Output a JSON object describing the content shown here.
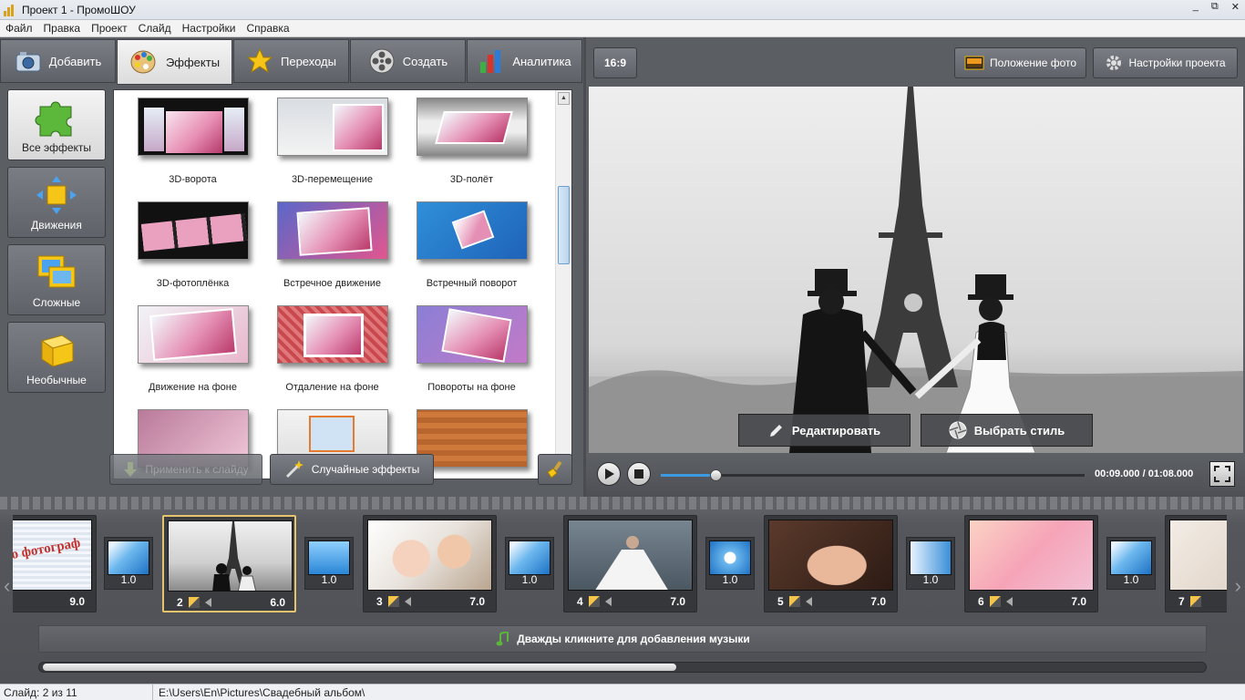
{
  "window": {
    "title": "Проект 1 - ПромоШОУ",
    "controls": [
      "_",
      "⧉",
      "✕"
    ]
  },
  "menu": [
    "Файл",
    "Правка",
    "Проект",
    "Слайд",
    "Настройки",
    "Справка"
  ],
  "tabs": [
    {
      "label": "Добавить",
      "icon": "camera-icon"
    },
    {
      "label": "Эффекты",
      "icon": "palette-icon",
      "active": true
    },
    {
      "label": "Переходы",
      "icon": "star-icon"
    },
    {
      "label": "Создать",
      "icon": "film-reel-icon"
    },
    {
      "label": "Аналитика",
      "icon": "bar-chart-icon"
    }
  ],
  "categories": [
    {
      "label": "Все эффекты",
      "icon": "puzzle-icon",
      "active": true
    },
    {
      "label": "Движения",
      "icon": "move-arrows-icon"
    },
    {
      "label": "Сложные",
      "icon": "layers-icon"
    },
    {
      "label": "Необычные",
      "icon": "cube-icon"
    }
  ],
  "effects": [
    "3D-ворота",
    "3D-перемещение",
    "3D-полёт",
    "3D-фотоплёнка",
    "Встречное движение",
    "Встречный поворот",
    "Движение на фоне",
    "Отдаление на фоне",
    "Повороты на фоне"
  ],
  "effect_buttons": {
    "apply": "Применить к слайду",
    "random": "Случайные эффекты"
  },
  "preview": {
    "aspect": "16:9",
    "photo_position": "Положение фото",
    "project_settings": "Настройки проекта",
    "edit": "Редактировать",
    "choose_style": "Выбрать стиль",
    "timecode": "00:09.000 / 01:08.000",
    "progress": 0.13
  },
  "slides": [
    {
      "num": "",
      "duration": "9.0",
      "label": "то фотограф"
    },
    {
      "num": "2",
      "duration": "6.0",
      "selected": true
    },
    {
      "num": "3",
      "duration": "7.0"
    },
    {
      "num": "4",
      "duration": "7.0"
    },
    {
      "num": "5",
      "duration": "7.0"
    },
    {
      "num": "6",
      "duration": "7.0"
    },
    {
      "num": "7",
      "duration": ""
    }
  ],
  "transitions": [
    "1.0",
    "1.0",
    "1.0",
    "1.0",
    "1.0",
    "1.0"
  ],
  "music_hint": "Дважды кликните для добавления музыки",
  "status": {
    "slide": "Слайд: 2 из 11",
    "path": "E:\\Users\\En\\Pictures\\Свадебный альбом\\"
  },
  "colors": {
    "accent": "#3c9be0",
    "selection": "#e6c46e",
    "panel": "#5b5e63"
  }
}
